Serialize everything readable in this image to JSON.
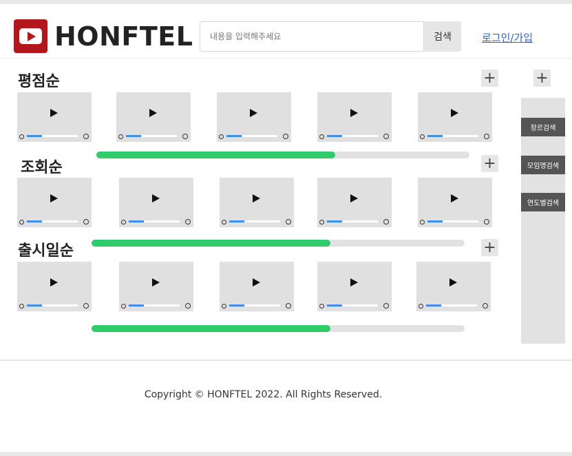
{
  "header": {
    "logo_text": "HONFTEL",
    "search_placeholder": "내용을 입력해주세요",
    "search_button": "검색",
    "login_link": "로그인/가입"
  },
  "sections": [
    {
      "title": "평점순",
      "plus": "+",
      "progress_percent": 64,
      "cards": [
        {
          "seek_percent": 30
        },
        {
          "seek_percent": 30
        },
        {
          "seek_percent": 30
        },
        {
          "seek_percent": 30
        },
        {
          "seek_percent": 30
        }
      ]
    },
    {
      "title": "조회순",
      "plus": "+",
      "progress_percent": 64,
      "cards": [
        {
          "seek_percent": 30
        },
        {
          "seek_percent": 30
        },
        {
          "seek_percent": 30
        },
        {
          "seek_percent": 30
        },
        {
          "seek_percent": 30
        }
      ]
    },
    {
      "title": "출시일순",
      "plus": "+",
      "progress_percent": 64,
      "cards": [
        {
          "seek_percent": 30
        },
        {
          "seek_percent": 30
        },
        {
          "seek_percent": 30
        },
        {
          "seek_percent": 30
        },
        {
          "seek_percent": 30
        }
      ]
    }
  ],
  "sidebar": {
    "plus": "+",
    "buttons": [
      "장르검색",
      "모임명검색",
      "연도별검색"
    ]
  },
  "footer": {
    "copyright": "Copyright © HONFTEL 2022. All Rights Reserved."
  },
  "colors": {
    "logo_red": "#b3161b",
    "progress_green": "#2ecc6b",
    "seek_blue": "#3f8ee8",
    "link_blue": "#2c5fe0"
  }
}
